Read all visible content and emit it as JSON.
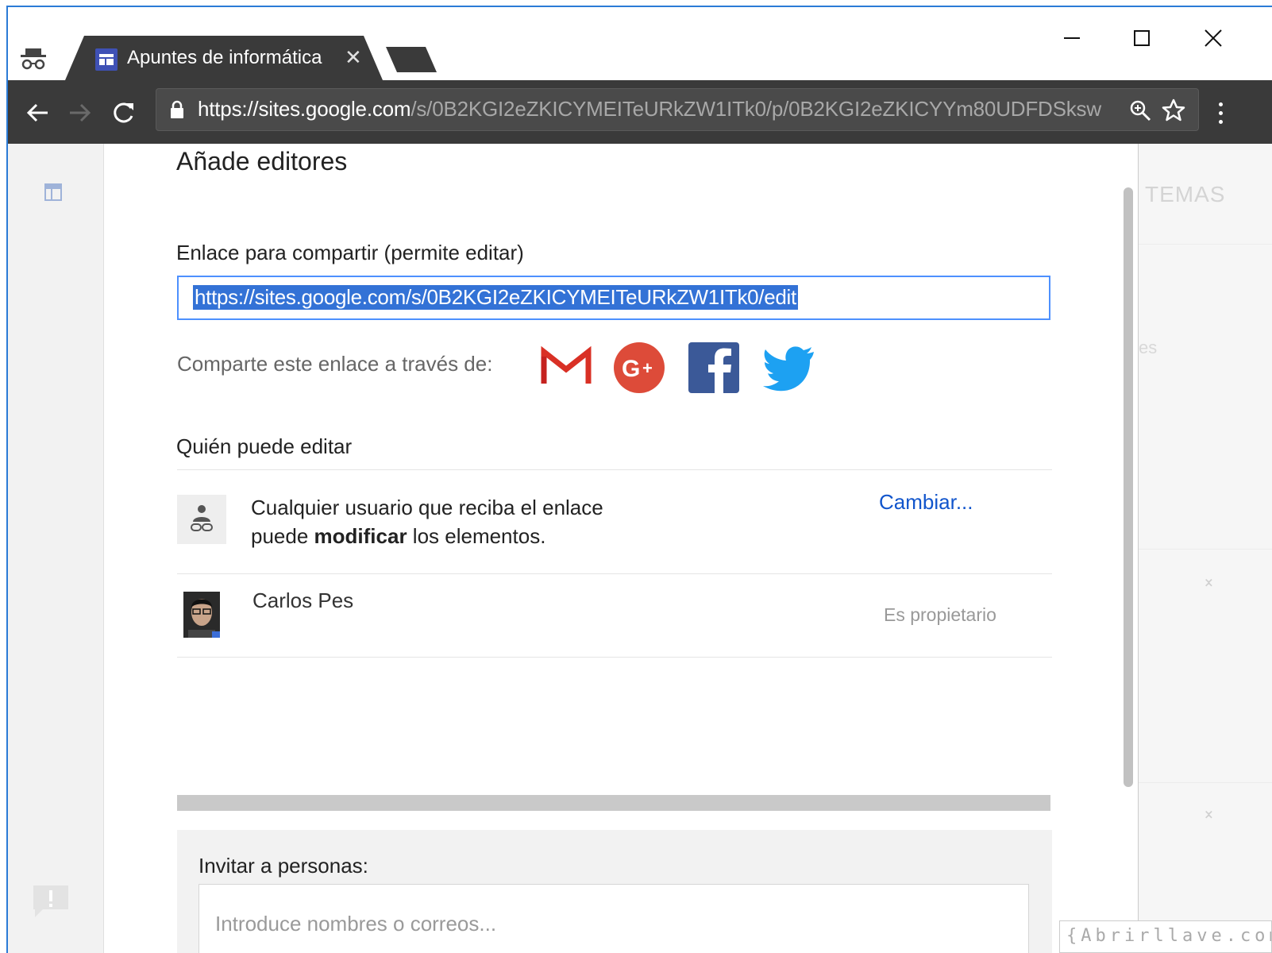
{
  "browser": {
    "tab": {
      "title": "Apuntes de informática",
      "close_glyph": "✕"
    },
    "address_bar": {
      "url_scheme": "https://",
      "url_host": "sites.google.com",
      "url_path": "/s/0B2KGI2eZKICYMEITeURkZW1ITk0/p/0B2KGI2eZKICYYm80UDFDSksw"
    },
    "icons": [
      "incognito-icon",
      "back-icon",
      "forward-icon",
      "reload-icon",
      "lock-icon",
      "zoom-icon",
      "star-icon",
      "menu-icon",
      "minimize-icon",
      "maximize-icon",
      "close-icon"
    ]
  },
  "background_page": {
    "right_heading": "TEMAS",
    "ghost_text": "es"
  },
  "dialog": {
    "title": "Añade editores",
    "share_link": {
      "label": "Enlace para compartir (permite editar)",
      "value": "https://sites.google.com/s/0B2KGI2eZKICYMEITeURkZW1ITk0/edit"
    },
    "share_via": {
      "label": "Comparte este enlace a través de:",
      "services": [
        "Gmail",
        "Google+",
        "Facebook",
        "Twitter"
      ]
    },
    "who_can_edit": {
      "label": "Quién puede editar",
      "anyone": {
        "line1": "Cualquier usuario que reciba el enlace",
        "line2_prefix": "puede ",
        "line2_bold": "modificar",
        "line2_suffix": " los elementos.",
        "change_link": "Cambiar..."
      },
      "owner": {
        "name": "Carlos Pes",
        "role": "Es propietario"
      }
    },
    "invite": {
      "label": "Invitar a personas:",
      "placeholder": "Introduce nombres o correos..."
    }
  },
  "watermark": "{Abrirllave.com",
  "colors": {
    "toolbar": "#3a3a3a",
    "link_blue": "#1155cc",
    "selection": "#3372d6",
    "gmail_red": "#d93025",
    "gplus_red": "#dd4b39",
    "facebook_blue": "#3b5998",
    "twitter_blue": "#1da1f2"
  }
}
